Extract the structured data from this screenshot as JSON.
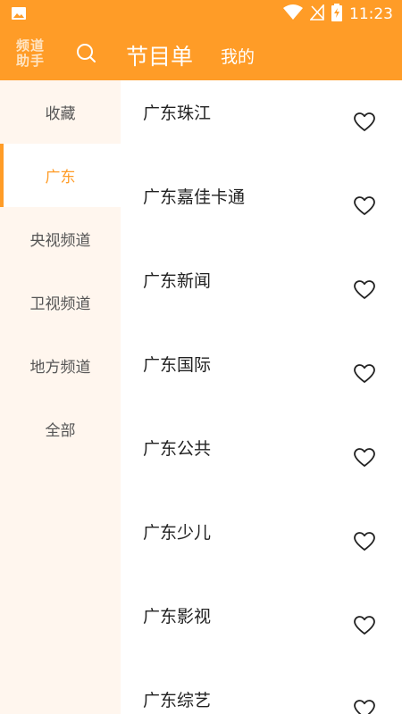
{
  "status_bar": {
    "time": "11:23"
  },
  "header": {
    "logo_line1": "频道",
    "logo_line2": "助手",
    "tabs": [
      {
        "label": "节目单",
        "active": true
      },
      {
        "label": "我的",
        "active": false
      }
    ]
  },
  "sidebar": {
    "items": [
      {
        "label": "收藏"
      },
      {
        "label": "广东"
      },
      {
        "label": "央视频道"
      },
      {
        "label": "卫视频道"
      },
      {
        "label": "地方频道"
      },
      {
        "label": "全部"
      }
    ],
    "selected": "广东"
  },
  "channels": [
    {
      "name": "广东珠江"
    },
    {
      "name": "广东嘉佳卡通"
    },
    {
      "name": "广东新闻"
    },
    {
      "name": "广东国际"
    },
    {
      "name": "广东公共"
    },
    {
      "name": "广东少儿"
    },
    {
      "name": "广东影视"
    },
    {
      "name": "广东综艺"
    }
  ],
  "colors": {
    "accent": "#ff9c27",
    "sidebar_bg": "#fff6ee"
  },
  "icons": [
    "image-icon",
    "wifi-icon",
    "signal-icon",
    "battery-icon",
    "search-icon",
    "heart-icon"
  ]
}
